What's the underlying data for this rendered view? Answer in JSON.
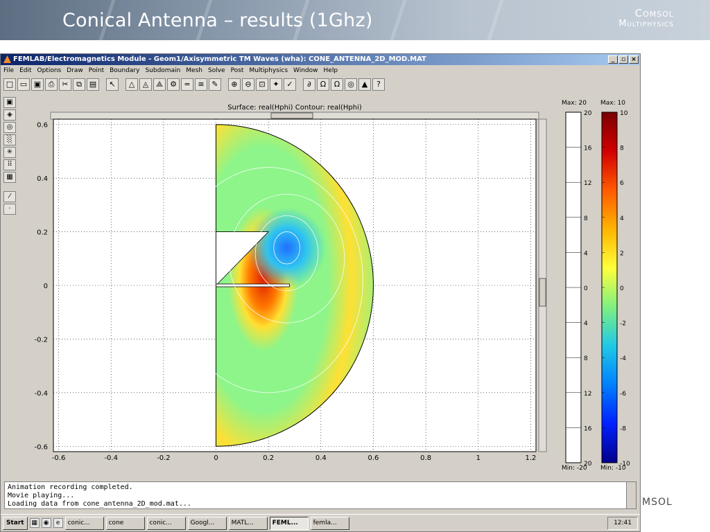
{
  "slide": {
    "title": "Conical Antenna – results (1Ghz)",
    "logo_line1": "Comsol",
    "logo_line2": "Multiphysics",
    "ghost_logo": "MSOL"
  },
  "window": {
    "title": "FEMLAB/Electromagnetics Module - Geom1/Axisymmetric TM Waves (wha): CONE_ANTENNA_2D_MOD.MAT",
    "minimize": "_",
    "maximize": "▫",
    "close": "×",
    "menus": [
      "File",
      "Edit",
      "Options",
      "Draw",
      "Point",
      "Boundary",
      "Subdomain",
      "Mesh",
      "Solve",
      "Post",
      "Multiphysics",
      "Window",
      "Help"
    ],
    "toolbar_icons": [
      "new-icon",
      "open-icon",
      "save-icon",
      "print-icon",
      "cut-icon",
      "copy-icon",
      "paste-icon",
      "pointer-icon",
      "triangle-icon",
      "triangle-mesh-icon",
      "refine-mesh-icon",
      "solve-icon",
      "equals-icon",
      "parameters-icon",
      "postprocess-icon",
      "zoom-in-icon",
      "zoom-out-icon",
      "zoom-window-icon",
      "zoom-extents-icon",
      "draw-mode-icon",
      "amplitude-icon",
      "omega-icon",
      "omega-sweep-icon",
      "sphere-icon",
      "animate-icon",
      "help-icon"
    ],
    "left_tools": [
      "surface-plot-icon",
      "boundary-plot-icon",
      "contour-plot-icon",
      "arrow-plot-icon",
      "streamline-plot-icon",
      "grid-icon",
      "movie-icon",
      "line-icon",
      "point-icon"
    ]
  },
  "chart_data": {
    "type": "heatmap",
    "title": "Surface: real(Hphi)  Contour: real(Hphi)",
    "xlabel": "",
    "ylabel": "",
    "x_ticks": [
      "-0.6",
      "-0.4",
      "-0.2",
      "0",
      "0.2",
      "0.4",
      "0.6",
      "0.8",
      "1",
      "1.2"
    ],
    "y_ticks": [
      "0.6",
      "0.4",
      "0.2",
      "0",
      "-0.2",
      "-0.4",
      "-0.6"
    ],
    "xlim": [
      -0.62,
      1.22
    ],
    "ylim": [
      -0.62,
      0.62
    ],
    "domain_radius": 0.6,
    "grid": true,
    "colorbar_contour": {
      "max_label": "Max: 20",
      "min_label": "Min: -20",
      "ticks": [
        "20",
        "16",
        "12",
        "8",
        "4",
        "0",
        "4",
        "8",
        "12",
        "16",
        "20"
      ]
    },
    "colorbar_surface": {
      "max_label": "Max: 10",
      "min_label": "Min: -10",
      "ticks": [
        "10",
        "8",
        "6",
        "4",
        "2",
        "0",
        "-2",
        "-4",
        "-6",
        "-8",
        "-10"
      ],
      "colors": [
        "#7a0000",
        "#d00000",
        "#ff5a00",
        "#ffb400",
        "#ffff3c",
        "#80f080",
        "#20c8e6",
        "#0080ff",
        "#0020ff",
        "#00008a"
      ]
    },
    "field_colors": {
      "background": "#8ef58a",
      "hot": "#e02000",
      "warm": "#ffe033",
      "cool": "#2ec4f0",
      "cold": "#2070ff"
    }
  },
  "console": {
    "lines": [
      "Animation recording completed.",
      "Movie playing...",
      "Loading data from cone_antenna_2D_mod.mat..."
    ]
  },
  "taskbar": {
    "start": "Start",
    "tasks": [
      "conic...",
      "cone",
      "conic...",
      "Googl...",
      "MATL...",
      "FEML...",
      "femla..."
    ],
    "active_task": "FEML...",
    "clock": "12:41"
  }
}
